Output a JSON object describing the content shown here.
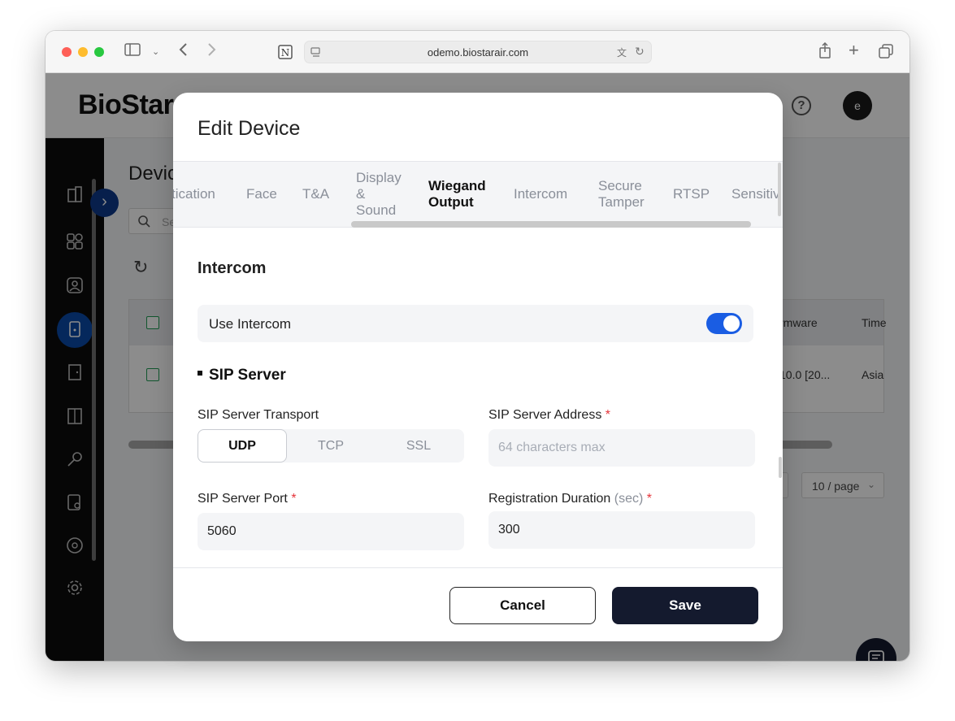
{
  "browser": {
    "url": "odemo.biostarair.com"
  },
  "app": {
    "logo": "BioStar",
    "avatar_initial": "e",
    "help_icon": "?"
  },
  "background_page": {
    "title": "Devic",
    "search_placeholder": "Se",
    "table": {
      "col_firmware": "rmware",
      "col_time": "Time",
      "row_firmware": "10.0 [20...",
      "row_time": "Asia"
    },
    "pager": "10 / page"
  },
  "modal": {
    "title": "Edit Device",
    "tabs": [
      {
        "label": "tication"
      },
      {
        "label": "Face"
      },
      {
        "label": "T&A"
      },
      {
        "label_lines": [
          "Display",
          "&",
          "Sound"
        ]
      },
      {
        "label_lines": [
          "Wiegand",
          "Output"
        ]
      },
      {
        "label": "Intercom"
      },
      {
        "label_lines": [
          "Secure",
          "Tamper"
        ]
      },
      {
        "label": "RTSP"
      },
      {
        "label": "Sensitiv"
      }
    ],
    "active_tab": "Wiegand Output",
    "section_title": "Intercom",
    "use_intercom": {
      "label": "Use Intercom",
      "enabled": true
    },
    "sip_server": {
      "title": "SIP Server",
      "transport_label": "SIP Server Transport",
      "transport_options": [
        "UDP",
        "TCP",
        "SSL"
      ],
      "transport_selected": "UDP",
      "address_label": "SIP Server Address",
      "address_placeholder": "64 characters max",
      "port_label": "SIP Server Port",
      "port_value": "5060",
      "duration_label": "Registration Duration",
      "duration_unit": "(sec)",
      "duration_value": "300",
      "required_mark": "*"
    },
    "cancel_label": "Cancel",
    "save_label": "Save"
  },
  "colors": {
    "accent": "#1a5de3",
    "primary_button": "#141a2e",
    "required": "#e5343a"
  }
}
